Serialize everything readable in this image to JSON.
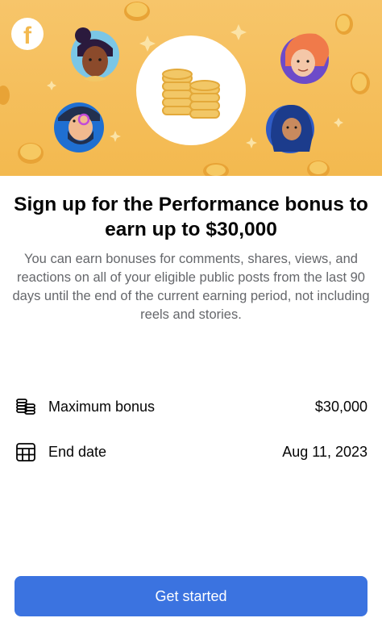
{
  "banner": {
    "logo_letter": "f",
    "background_color": "#f3b94f",
    "illustration": "coin-stack-icon"
  },
  "title": "Sign up for the Performance bonus to earn up to $30,000",
  "description": "You can earn bonuses for comments, shares, views, and reactions on all of your eligible public posts from the last 90 days until the end of the current earning period, not including reels and stories.",
  "details": [
    {
      "icon": "coin-stack-icon",
      "label": "Maximum bonus",
      "value": "$30,000"
    },
    {
      "icon": "calendar-icon",
      "label": "End date",
      "value": "Aug 11, 2023"
    }
  ],
  "cta": {
    "label": "Get started",
    "color": "#3b73e0"
  }
}
